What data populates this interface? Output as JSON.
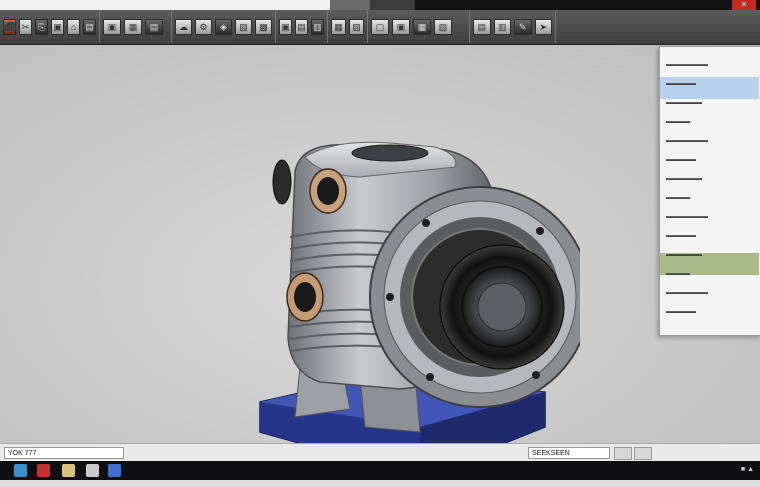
{
  "window": {
    "close_glyph": "✕"
  },
  "ribbon": {
    "groups": [
      {
        "id": "g1",
        "buttons": [
          "⬛",
          "✂",
          "⎘",
          "▣",
          "⌂",
          "▤"
        ]
      },
      {
        "id": "g2",
        "buttons": [
          "▣",
          "▦",
          "▤"
        ]
      },
      {
        "id": "g3",
        "buttons": [
          "☁",
          "⚙",
          "◈",
          "▧",
          "▩"
        ]
      },
      {
        "id": "g4",
        "buttons": [
          "▣",
          "▤",
          "▥"
        ]
      },
      {
        "id": "g5",
        "buttons": [
          "▦",
          "▧"
        ]
      },
      {
        "id": "g6",
        "buttons": [
          "▢",
          "▣",
          "▦",
          "▧"
        ]
      },
      {
        "id": "g7",
        "buttons": [
          "▤",
          "▥",
          "✎",
          "➤"
        ]
      }
    ]
  },
  "status": {
    "left_text": "YOK 777",
    "right_text": "SEEKSEEN"
  },
  "taskbar": {
    "items": [
      "start",
      "browser",
      "app-red",
      "folder",
      "files",
      "edge"
    ],
    "tray_text": "■ ▲"
  },
  "panel": {
    "rows": [
      "▬▬▬▬▬▬▬",
      "▬▬▬▬▬",
      "▬▬▬▬▬▬",
      "▬▬▬▬",
      "▬▬▬▬▬▬▬",
      "▬▬▬▬▬",
      "▬▬▬▬▬▬",
      "▬▬▬▬",
      "▬▬▬▬▬▬▬",
      "▬▬▬▬▬",
      "▬▬▬▬▬▬",
      "▬▬▬▬",
      "▬▬▬▬▬▬▬",
      "▬▬▬▬▬"
    ]
  },
  "colors": {
    "ribbon_bg": "#4a4a4a",
    "viewport_bg": "#cfcfcf",
    "panel_highlight_blue": "#b8d2ee",
    "panel_highlight_green": "#a9bb87",
    "base_blue": "#2b3d8f",
    "body_gray": "#a6a8ad"
  }
}
